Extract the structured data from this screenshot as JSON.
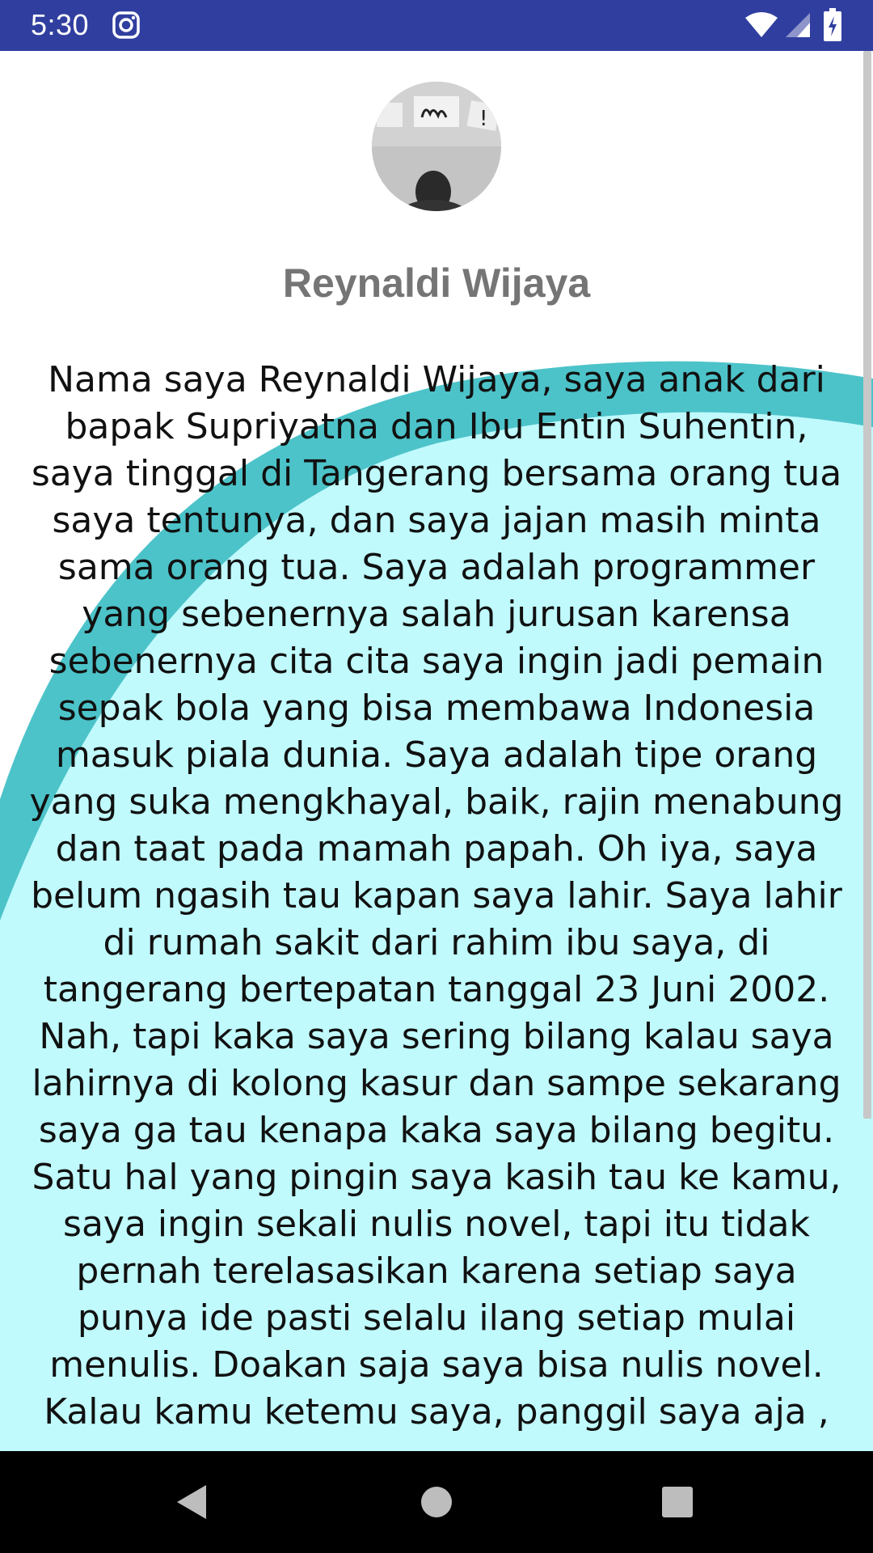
{
  "status_bar": {
    "time": "5:30",
    "background": "#303f9f",
    "icons": [
      "instagram-icon",
      "wifi-icon",
      "signal-icon",
      "battery-icon"
    ]
  },
  "profile": {
    "avatar_icon": "profile-avatar",
    "name": "Reynaldi Wijaya",
    "bio": "Nama saya Reynaldi Wijaya, saya anak dari bapak Supriyatna dan Ibu Entin Suhentin, saya tinggal di Tangerang bersama orang tua saya tentunya, dan saya jajan masih minta sama orang tua. Saya adalah programmer yang sebenernya salah jurusan karensa sebenernya cita cita saya ingin jadi pemain sepak bola yang bisa membawa Indonesia masuk piala dunia. Saya adalah tipe orang yang suka mengkhayal, baik, rajin menabung dan taat pada mamah papah. Oh iya, saya belum ngasih tau kapan saya lahir. Saya lahir di rumah sakit dari rahim ibu saya, di tangerang bertepatan tanggal 23 Juni 2002. Nah, tapi kaka saya sering bilang kalau saya lahirnya di kolong kasur dan sampe sekarang saya ga tau kenapa kaka saya bilang begitu. Satu hal yang pingin saya kasih tau ke kamu, saya ingin sekali nulis novel, tapi itu tidak pernah terelasasikan karena setiap saya punya ide pasti selalu ilang setiap mulai menulis. Doakan saja saya bisa nulis novel. Kalau kamu ketemu saya, panggil saya aja ,"
  },
  "colors": {
    "accent_teal": "#4cc3c9",
    "light_cyan": "#c0fafd",
    "name_gray": "#757575"
  },
  "nav_bar": {
    "buttons": [
      "back-icon",
      "home-icon",
      "recents-icon"
    ]
  }
}
